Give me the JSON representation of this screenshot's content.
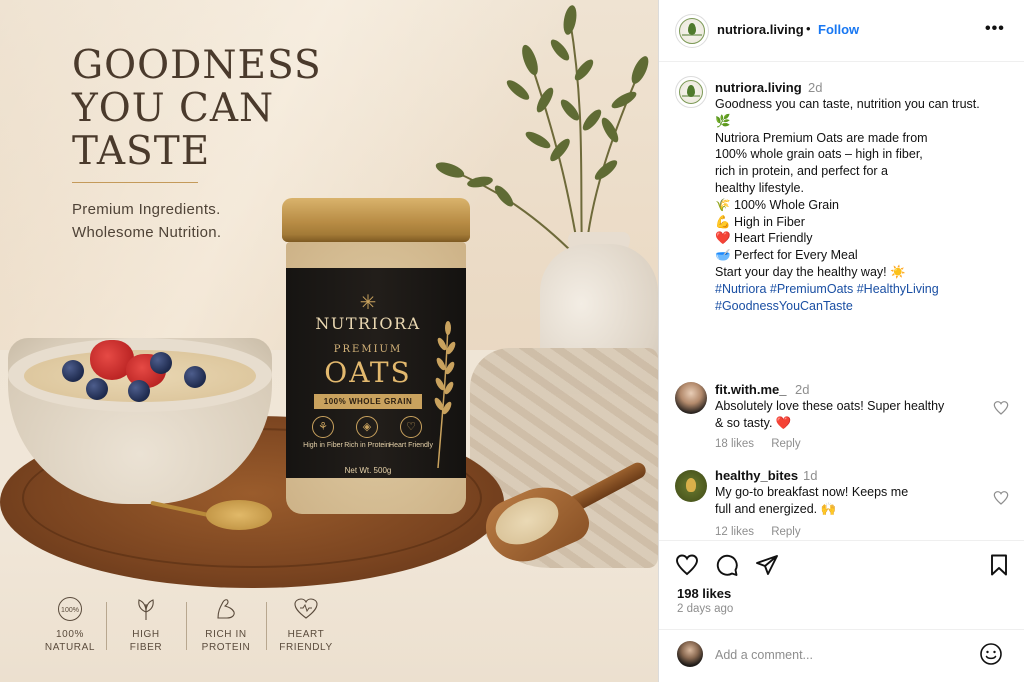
{
  "post_image": {
    "headline_lines": [
      "GOODNESS",
      "YOU CAN",
      "TASTE"
    ],
    "subline_lines": [
      "Premium Ingredients.",
      "Wholesome Nutrition."
    ],
    "jar": {
      "brand": "NUTRIORA",
      "premium": "PREMIUM",
      "product": "OATS",
      "badge": "100% WHOLE GRAIN",
      "features": [
        {
          "icon": "wheat-icon",
          "label": "High in Fiber"
        },
        {
          "icon": "protein-icon",
          "label": "Rich in Protein"
        },
        {
          "icon": "heart-icon",
          "label": "Heart Friendly"
        }
      ],
      "weight": "Net Wt. 500g"
    },
    "bottom_features": [
      {
        "icon": "natural-badge-icon",
        "badge_text": "100%",
        "line1": "100%",
        "line2": "NATURAL"
      },
      {
        "icon": "leaf-icon",
        "line1": "HIGH",
        "line2": "FIBER"
      },
      {
        "icon": "muscle-icon",
        "line1": "RICH IN",
        "line2": "PROTEIN"
      },
      {
        "icon": "heart-icon",
        "line1": "HEART",
        "line2": "FRIENDLY"
      }
    ],
    "colors": {
      "headline": "#4a3a2c",
      "gold": "#c49a5a",
      "jar_label": "#161412"
    }
  },
  "header": {
    "username": "nutriora.living",
    "separator": "•",
    "follow_label": "Follow",
    "more_icon": "more-dots-icon",
    "more_glyph": "•••"
  },
  "caption": {
    "username": "nutriora.living",
    "time": "2d",
    "lines": [
      "Goodness you can taste, nutrition you can trust. 🌿",
      "",
      "Nutriora Premium Oats are made from",
      "100% whole grain oats – high in fiber,",
      "rich in protein, and perfect for a",
      "healthy lifestyle.",
      "",
      "🌾 100% Whole Grain",
      "💪 High in Fiber",
      "❤️ Heart Friendly",
      "🥣 Perfect for Every Meal",
      "",
      "Start your day the healthy way! ☀️",
      ""
    ],
    "hashtags": [
      "#Nutriora #PremiumOats #HealthyLiving",
      "#GoodnessYouCanTaste"
    ]
  },
  "comments": [
    {
      "username": "fit.with.me_",
      "time": "2d",
      "text": "Absolutely love these oats! Super healthy & so tasty. ❤️",
      "likes": "18 likes",
      "reply_label": "Reply"
    },
    {
      "username": "healthy_bites",
      "time": "1d",
      "text": "My go-to breakfast now! Keeps me full and energized. 🙌",
      "likes": "12 likes",
      "reply_label": "Reply"
    }
  ],
  "actions": {
    "likes": "198 likes",
    "time": "2 days ago",
    "icons": [
      "heart-icon",
      "comment-icon",
      "share-icon",
      "bookmark-icon"
    ]
  },
  "add_comment": {
    "placeholder": "Add a comment...",
    "emoji_icon": "emoji-icon"
  },
  "colors": {
    "follow": "#1877f2",
    "hashtag": "#1a4fa3",
    "muted": "#8e8e8e",
    "like_heart": "#e0245e"
  }
}
